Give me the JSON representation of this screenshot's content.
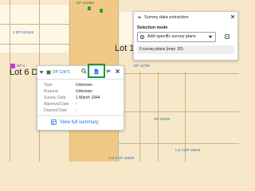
{
  "map": {
    "lots": {
      "lot1": "Lot 1",
      "lot6": "Lot 6 DI"
    },
    "labels": {
      "top_dp": "DP 211566",
      "dp_left": "4 DP 520446",
      "dp_dp4": "DP 4",
      "dp_42708": "DP 42708",
      "sp_1": "SP 19750",
      "sp_2": "SO 19750",
      "dp_bottom1": "Lot 3 DP 18548",
      "dp_bottom2": "Lot 2 DP 18548"
    }
  },
  "panel": {
    "title": "Survey data extraction",
    "mode_label": "Selection mode",
    "mode_value": "Add specific survey plans",
    "summary": "0 survey plans (max: 20)"
  },
  "popup": {
    "title": "DP 12471",
    "rows": [
      {
        "label": "Type",
        "value": "Unknown"
      },
      {
        "label": "Purpose",
        "value": "Unknown"
      },
      {
        "label": "Survey Date",
        "value": "1 March 1944"
      },
      {
        "label": "Approval Date",
        "value": "-"
      },
      {
        "label": "Deposit Date",
        "value": "-"
      }
    ],
    "view_label": "View full summary"
  },
  "colors": {
    "accent": "#1a73e8",
    "highlight": "#0d9b3c",
    "map_background": "#f6e8c8",
    "map_band": "#f1c987"
  },
  "icons": [
    "chevron-down-icon",
    "close-icon",
    "gear-icon",
    "dropdown-arrow-icon",
    "layers-icon",
    "document-icon",
    "table-icon",
    "search-icon",
    "menu-icon"
  ]
}
